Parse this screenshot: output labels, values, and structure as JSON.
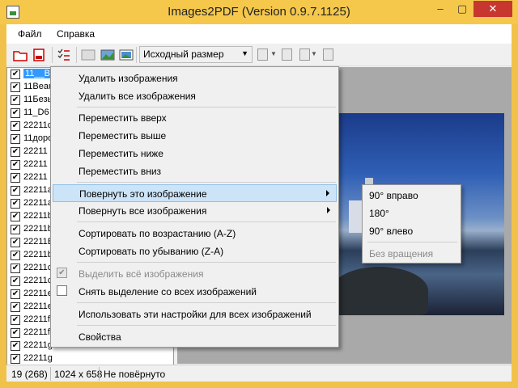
{
  "window": {
    "title": "Images2PDF (Version 0.9.7.1125)",
    "minimize": "–",
    "maximize": "▢",
    "close": "✕"
  },
  "menubar": {
    "file": "Файл",
    "help": "Справка"
  },
  "toolbar": {
    "size_value": "Исходный размер",
    "dropdown_arrow": "▼"
  },
  "file_list": {
    "items": [
      "11__B5",
      "11Beau",
      "11Безь",
      "11_D6",
      "22211c",
      "11доро",
      "22211",
      "22211",
      "22211",
      "22211a",
      "22211a",
      "22211b",
      "22211b",
      "22211B",
      "22211b",
      "22211c",
      "22211c",
      "22211e",
      "22211e",
      "22211f",
      "22211f",
      "22211g",
      "22211g"
    ],
    "check": "✔",
    "scroll_left": "<",
    "scroll_right": ">"
  },
  "context_menu": {
    "delete_image": "Удалить изображения",
    "delete_all": "Удалить все изображения",
    "move_top": "Переместить вверх",
    "move_up": "Переместить выше",
    "move_down": "Переместить ниже",
    "move_bottom": "Переместить вниз",
    "rotate_this": "Повернуть это изображение",
    "rotate_all": "Повернуть все изображения",
    "sort_asc": "Сортировать по возрастанию (A-Z)",
    "sort_desc": "Сортировать по убыванию (Z-A)",
    "select_all": "Выделить всё изображения",
    "deselect_all": "Снять выделение со всех изображений",
    "apply_all": "Использовать эти настройки для всех изображений",
    "properties": "Свойства",
    "check_mark": "✔"
  },
  "rotate_submenu": {
    "right": "90° вправо",
    "r180": "180°",
    "left": "90° влево",
    "none": "Без вращения"
  },
  "statusbar": {
    "count": "19 (268)",
    "dimensions": "1024 x 658",
    "rotation": "Не повёрнуто"
  },
  "colors": {
    "titlebar": "#f5c84c",
    "close": "#c7372f",
    "highlight": "#cce4f7",
    "selection": "#3399ff"
  }
}
